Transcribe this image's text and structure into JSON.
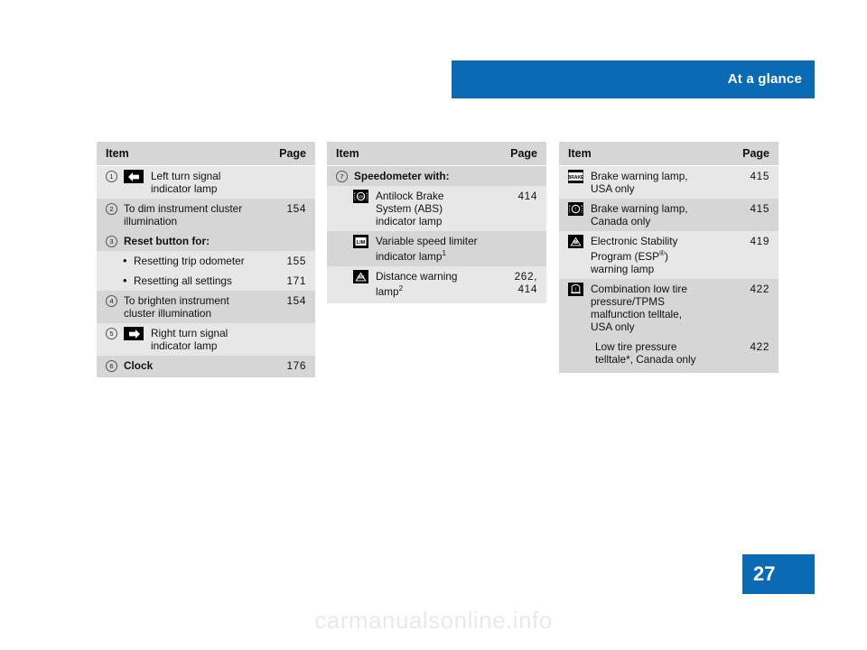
{
  "header": {
    "title": "At a glance"
  },
  "page_number": "27",
  "watermark": "carmanualsonline.info",
  "tables": [
    {
      "id": "table-left",
      "head": {
        "item": "Item",
        "page": "Page"
      },
      "rows": [
        {
          "num": "1",
          "symbol": "left-turn-arrow",
          "text": "Left turn signal\nindicator lamp",
          "page": "",
          "alt": true
        },
        {
          "num": "2",
          "symbol": "",
          "text": "To dim instrument cluster\nillumination",
          "page": "154",
          "alt": false
        },
        {
          "num": "3",
          "symbol": "",
          "text": "Reset button for:",
          "page": "",
          "bold": true,
          "alt": false
        },
        {
          "num": "",
          "bullet": "•",
          "symbol": "",
          "text": "Resetting trip odometer",
          "page": "155",
          "alt": true
        },
        {
          "num": "",
          "bullet": "•",
          "symbol": "",
          "text": "Resetting all settings",
          "page": "171",
          "alt": true
        },
        {
          "num": "4",
          "symbol": "",
          "text": "To brighten instrument\ncluster illumination",
          "page": "154",
          "alt": false
        },
        {
          "num": "5",
          "symbol": "right-turn-arrow",
          "text": "Right turn signal\nindicator lamp",
          "page": "",
          "alt": true
        },
        {
          "num": "6",
          "symbol": "",
          "text": "Clock",
          "page": "176",
          "bold": true,
          "alt": false
        }
      ]
    },
    {
      "id": "table-middle",
      "head": {
        "item": "Item",
        "page": "Page"
      },
      "rows": [
        {
          "num": "7",
          "symbol": "",
          "text": "Speedometer with:",
          "page": "",
          "bold": true,
          "alt": false
        },
        {
          "num": "",
          "symbol": "abs-lamp",
          "text": "Antilock Brake\nSystem (ABS)\nindicator lamp",
          "page": "414",
          "alt": true
        },
        {
          "num": "",
          "symbol": "lim-lamp",
          "text": "Variable speed limiter\nindicator lamp¹",
          "page": "",
          "alt": false
        },
        {
          "num": "",
          "symbol": "distance-warning-lamp",
          "text": "Distance warning\nlamp²",
          "page": "262,\n414",
          "alt": true
        }
      ]
    },
    {
      "id": "table-right",
      "head": {
        "item": "Item",
        "page": "Page"
      },
      "rows": [
        {
          "num": "",
          "symbol": "brake-text-lamp",
          "text": "Brake warning lamp,\nUSA only",
          "page": "415",
          "alt": true
        },
        {
          "num": "",
          "symbol": "brake-circle-lamp",
          "text": "Brake warning lamp,\nCanada only",
          "page": "415",
          "alt": false
        },
        {
          "num": "",
          "symbol": "esp-lamp",
          "text": "Electronic Stability\nProgram (ESP®)\nwarning lamp",
          "page": "419",
          "alt": true
        },
        {
          "num": "",
          "symbol": "tire-pressure-lamp",
          "text": "Combination low tire\npressure/TPMS\nmalfunction telltale,\nUSA only",
          "page": "422",
          "alt": false
        },
        {
          "num": "",
          "symbol": "",
          "text": "Low tire pressure\ntelltale*, Canada only",
          "page": "422",
          "alt": false
        }
      ]
    }
  ],
  "colors": {
    "accent": "#0a6ab4",
    "table_bg": "#d6d6d6",
    "table_alt_bg": "#e7e7e7"
  }
}
